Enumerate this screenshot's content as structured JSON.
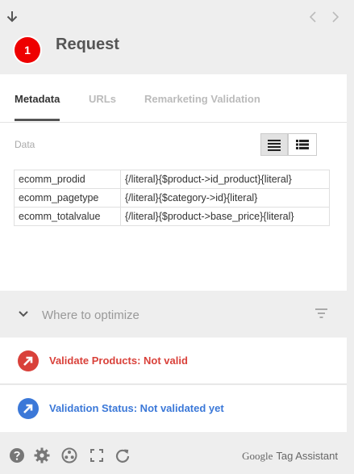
{
  "request": {
    "number": "1",
    "title": "Request"
  },
  "tabs": [
    {
      "label": "Metadata",
      "active": true
    },
    {
      "label": "URLs",
      "active": false
    },
    {
      "label": "Remarketing Validation",
      "active": false
    }
  ],
  "data_section": {
    "label": "Data",
    "rows": [
      {
        "key": "ecomm_prodid",
        "value": "{/literal}{$product->id_product}{literal}"
      },
      {
        "key": "ecomm_pagetype",
        "value": "{/literal}{$category->id}{literal}"
      },
      {
        "key": "ecomm_totalvalue",
        "value": "{/literal}{$product->base_price}{literal}"
      }
    ]
  },
  "optimize": {
    "label": "Where to optimize"
  },
  "results": [
    {
      "text": "Validate Products: Not valid",
      "color": "#d9413a",
      "icon": "arrow-up-right-icon"
    },
    {
      "text": "Validation Status: Not validated yet",
      "color": "#3b78d8",
      "icon": "arrow-up-right-icon"
    }
  ],
  "footer": {
    "icons": [
      "help-icon",
      "gear-icon",
      "record-icon",
      "fullscreen-icon",
      "refresh-icon"
    ],
    "brand_google": "Google",
    "brand_product": "Tag Assistant"
  }
}
